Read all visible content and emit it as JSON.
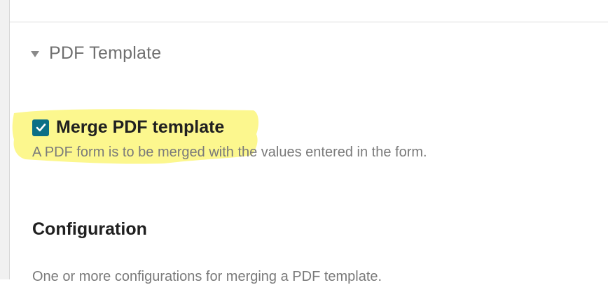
{
  "section": {
    "title": "PDF Template",
    "expanded": true
  },
  "merge_field": {
    "label": "Merge PDF template",
    "checked": true,
    "description": "A PDF form is to be merged with the values entered in the form."
  },
  "configuration": {
    "label": "Configuration",
    "description": "One or more configurations for merging a PDF template."
  },
  "colors": {
    "checkbox": "#0b6f86",
    "highlight": "#fbf67a"
  },
  "icons": {
    "section_toggle": "triangle-down-icon",
    "checkbox_mark": "checkmark-icon"
  }
}
